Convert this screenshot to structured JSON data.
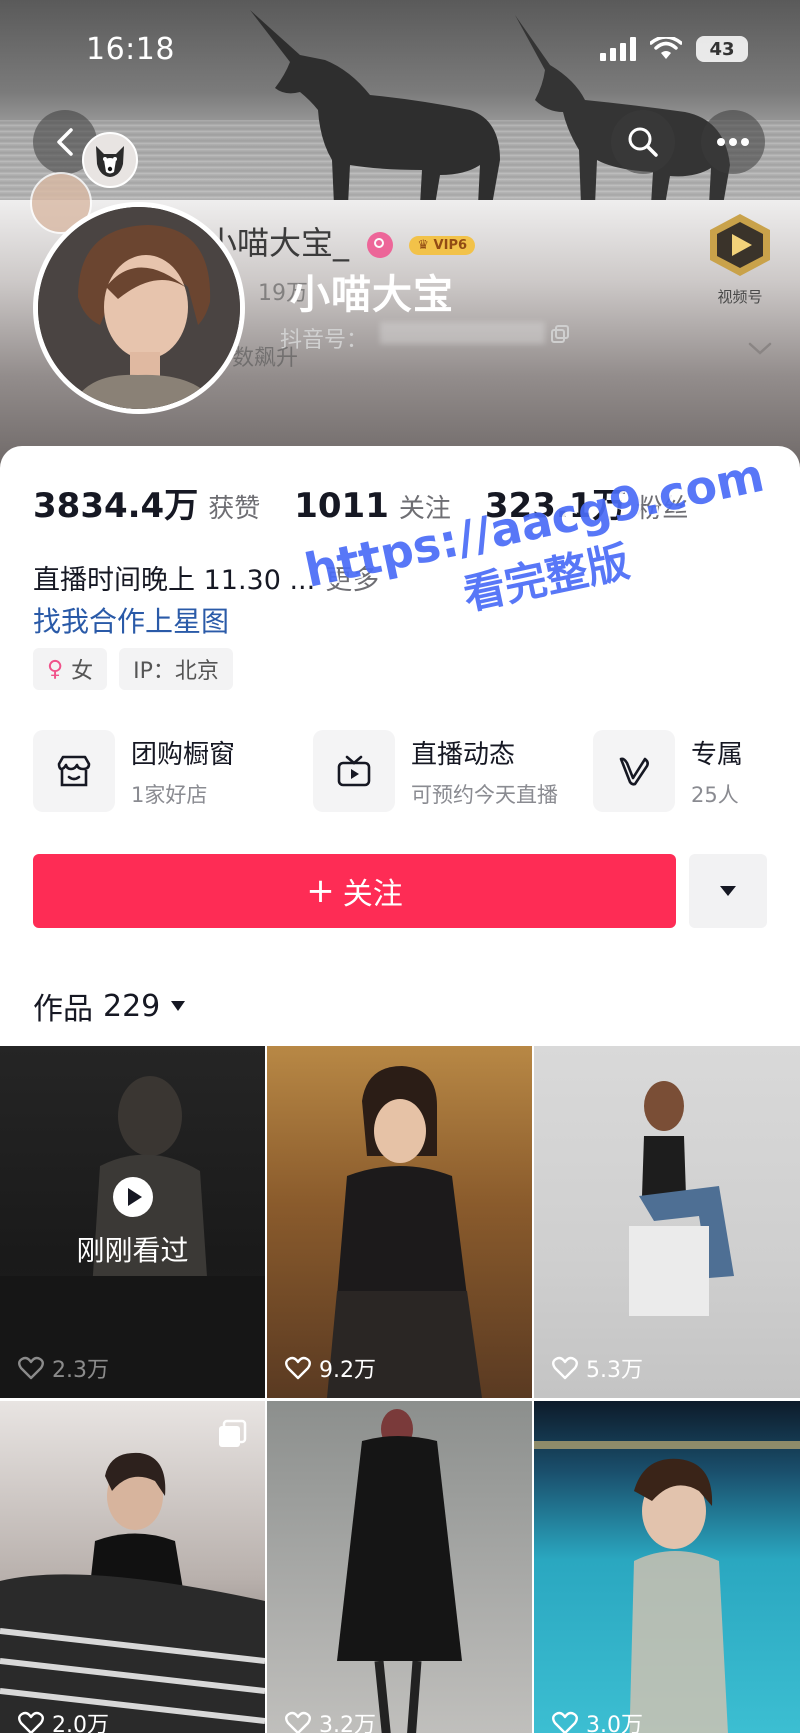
{
  "status_bar": {
    "time": "16:18",
    "battery": "43"
  },
  "profile": {
    "name_faded": "小喵大宝_",
    "name": "小喵大宝",
    "douyin_id_label": "抖音号：",
    "faded_age_text": "19万",
    "faded_rank_text": "数飙升",
    "video_badge_label": "视频号",
    "vip_label": "VIP6"
  },
  "stats": [
    {
      "value": "3834.4万",
      "label": "获赞"
    },
    {
      "value": "1011",
      "label": "关注"
    },
    {
      "value": "323.1万",
      "label": "粉丝"
    }
  ],
  "bio": {
    "text": "直播时间晚上 11.30 ...",
    "more": "更多",
    "collab": "找我合作上星图"
  },
  "tags": {
    "gender": "女",
    "ip": "IP：北京"
  },
  "services": [
    {
      "title": "团购橱窗",
      "subtitle": "1家好店",
      "icon": "shop-icon"
    },
    {
      "title": "直播动态",
      "subtitle": "可预约今天直播",
      "icon": "tv-icon"
    },
    {
      "title": "专属",
      "subtitle": "25人",
      "icon": "v-icon"
    }
  ],
  "actions": {
    "follow": "关注"
  },
  "works": {
    "label": "作品",
    "count": "229"
  },
  "videos": [
    {
      "likes": "2.3万",
      "recent_label": "刚刚看过"
    },
    {
      "likes": "9.2万"
    },
    {
      "likes": "5.3万"
    },
    {
      "likes": "2.0万"
    },
    {
      "likes": "3.2万"
    },
    {
      "likes": "3.0万"
    }
  ],
  "watermark": {
    "line1": "https://aacg9.com",
    "line2": "看完整版"
  },
  "colors": {
    "follow": "#fe2c55",
    "link": "#2a5aa8",
    "watermark": "#4a6cf7"
  }
}
